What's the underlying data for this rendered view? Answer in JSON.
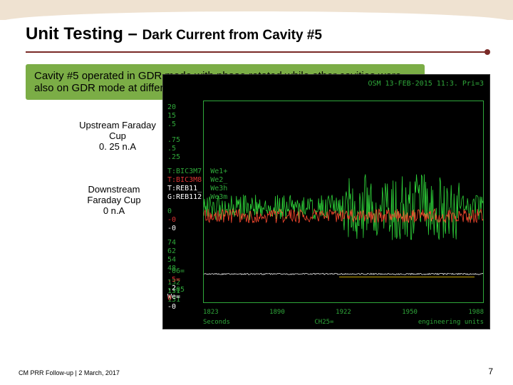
{
  "title": {
    "main": "Unit Testing",
    "separator": " – ",
    "sub": "Dark Current from Cavity #5"
  },
  "callout": "Cavity #5 operated in GDR mode with phase rotated while other cavities were also on GDR mode at different phase",
  "labels": {
    "upstream": {
      "name": "Upstream Faraday Cup",
      "value": "0. 25 n.A"
    },
    "downstream": {
      "name": "Downstream Faraday Cup",
      "value": "0 n.A"
    }
  },
  "scope": {
    "topbar": "OSM 13-FEB-2015 11:3.  Pri=3",
    "left_block1": [
      "20",
      "15",
      ".5"
    ],
    "left_block2": [
      ".75",
      ".5",
      ".25"
    ],
    "left_traces": [
      "T:BIC3M7",
      "T:BIC3M8",
      "T:REB11_",
      "G:REB112"
    ],
    "left_trace_cols": [
      "g",
      "r",
      "w",
      "w"
    ],
    "left_block3": [
      "0",
      "-0",
      "-0"
    ],
    "left_block4": [
      "74",
      "62",
      "54",
      "48"
    ],
    "left_block5": [
      "132",
      "131",
      "131"
    ],
    "left_block6": [
      "We1+",
      "We2_",
      "We3h",
      "We3m"
    ],
    "left_block7": [
      ".06=",
      ".5=",
      ".2",
      "We="
    ],
    "left_block8": [
      "-.05",
      "0",
      "-0"
    ],
    "xaxis": [
      "1823",
      "1890",
      "1922",
      "1950",
      "1988"
    ],
    "xlabel_left": "Seconds",
    "xlabel_mid": "CH25=",
    "xlabel_right": "engineering units"
  },
  "footer": "CM PRR Follow-up | 2 March, 2017",
  "page": "7"
}
